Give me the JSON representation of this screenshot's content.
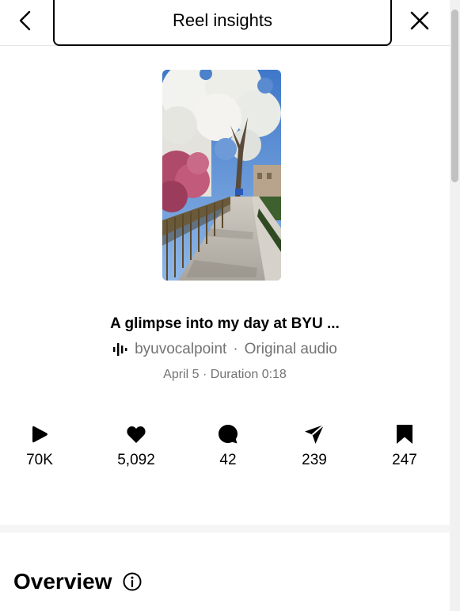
{
  "header": {
    "title": "Reel insights",
    "back_icon": "chevron-left-icon",
    "close_icon": "close-icon"
  },
  "reel": {
    "caption": "A glimpse into my day at BYU ...",
    "audio_icon": "audio-waveform-icon",
    "audio_owner": "byuvocalpoint",
    "audio_separator": "·",
    "audio_label": "Original audio",
    "date": "April 5",
    "meta_separator": "·",
    "duration": "Duration 0:18"
  },
  "stats": [
    {
      "icon": "play-icon",
      "value": "70K"
    },
    {
      "icon": "heart-icon",
      "value": "5,092"
    },
    {
      "icon": "comment-icon",
      "value": "42"
    },
    {
      "icon": "share-icon",
      "value": "239"
    },
    {
      "icon": "bookmark-icon",
      "value": "247"
    }
  ],
  "overview": {
    "title": "Overview",
    "info_icon": "info-icon"
  },
  "colors": {
    "text_primary": "#000000",
    "text_secondary": "#737373",
    "divider": "#f5f5f5"
  }
}
